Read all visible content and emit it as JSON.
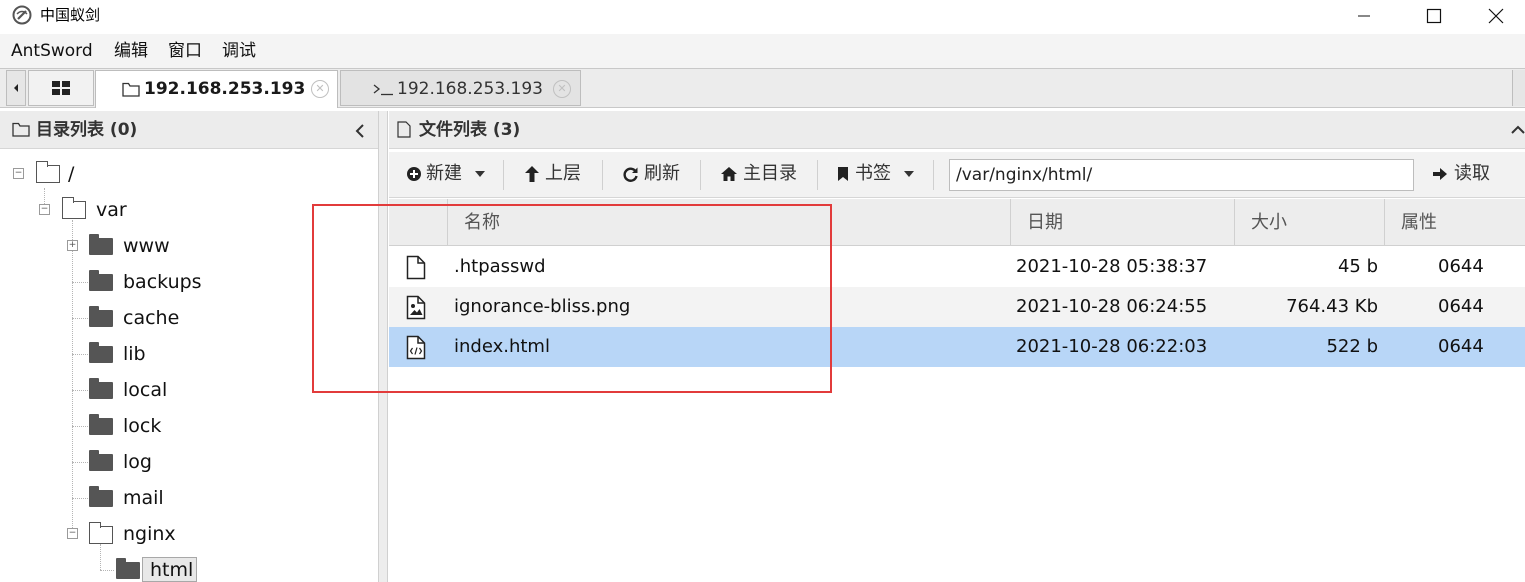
{
  "window": {
    "title": "中国蚁剑",
    "icon": "antsword-logo-icon"
  },
  "menu": [
    "AntSword",
    "编辑",
    "窗口",
    "调试"
  ],
  "tabs": [
    {
      "icon": "folder-icon",
      "label": "192.168.253.193",
      "active": true
    },
    {
      "icon": "terminal-icon",
      "label": "192.168.253.193",
      "active": false
    }
  ],
  "left_panel": {
    "title": "目录列表 (0)",
    "tree": {
      "root": "/",
      "var": "var",
      "children": [
        "www",
        "backups",
        "cache",
        "lib",
        "local",
        "lock",
        "log",
        "mail",
        "nginx"
      ],
      "html": "html"
    }
  },
  "right_panel": {
    "title": "文件列表 (3)",
    "toolbar": {
      "new_label": "新建",
      "up_label": "上层",
      "refresh_label": "刷新",
      "home_label": "主目录",
      "bookmark_label": "书签",
      "path": "/var/nginx/html/",
      "read_label": "读取"
    },
    "columns": {
      "name": "名称",
      "date": "日期",
      "size": "大小",
      "attr": "属性"
    },
    "files": [
      {
        "icon": "file-icon",
        "name": ".htpasswd",
        "date": "2021-10-28 05:38:37",
        "size": "45 b",
        "attr": "0644"
      },
      {
        "icon": "image-file-icon",
        "name": "ignorance-bliss.png",
        "date": "2021-10-28 06:24:55",
        "size": "764.43 Kb",
        "attr": "0644"
      },
      {
        "icon": "code-file-icon",
        "name": "index.html",
        "date": "2021-10-28 06:22:03",
        "size": "522 b",
        "attr": "0644"
      }
    ]
  },
  "colors": {
    "selected_row": "#b8d6f7",
    "alt_row": "#f3f3f3",
    "highlight_box": "#e23b3b"
  }
}
